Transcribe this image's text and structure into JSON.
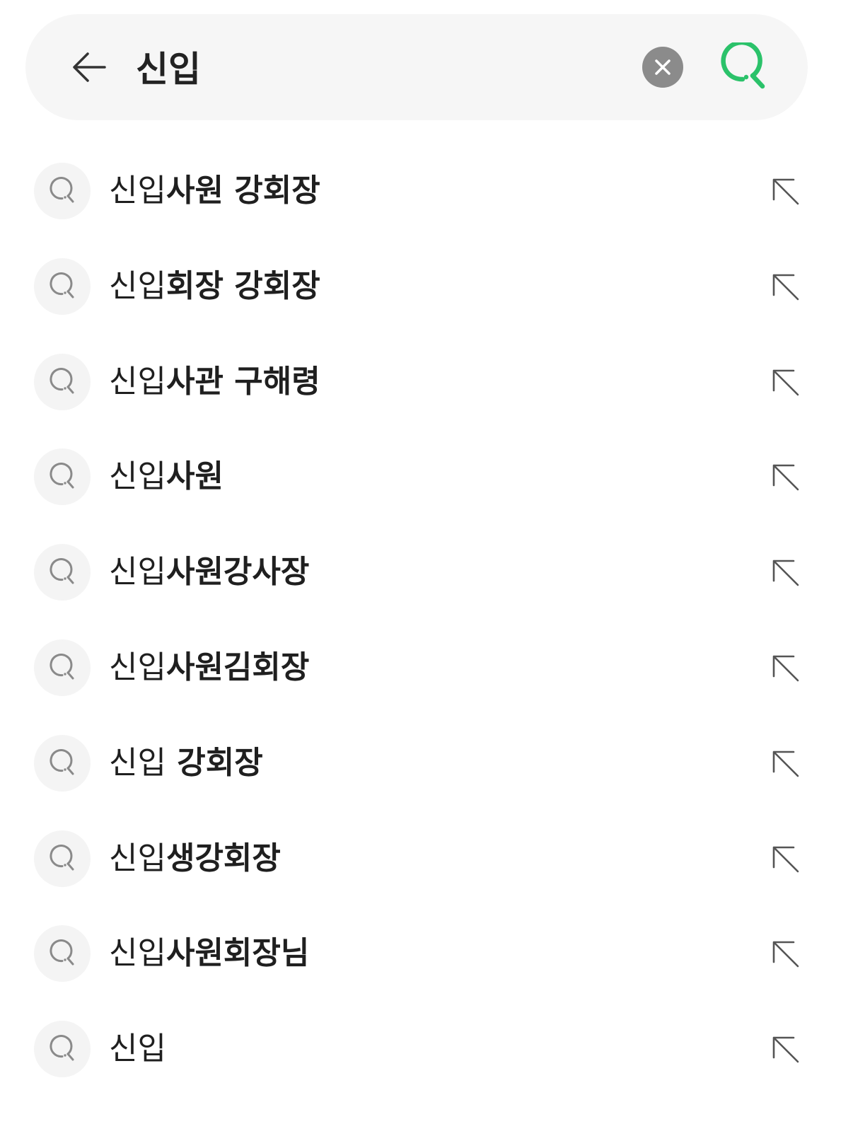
{
  "search": {
    "query": "신입",
    "accent_color": "#2bc26a",
    "clear_color": "#8b8b8b",
    "back_icon": "arrow-left-icon",
    "clear_icon": "close-circle-icon",
    "search_icon": "search-icon"
  },
  "suggestions": [
    {
      "match": "신입",
      "rest": "사원 강회장"
    },
    {
      "match": "신입",
      "rest": "회장 강회장"
    },
    {
      "match": "신입",
      "rest": "사관 구해령"
    },
    {
      "match": "신입",
      "rest": "사원"
    },
    {
      "match": "신입",
      "rest": "사원강사장"
    },
    {
      "match": "신입",
      "rest": "사원김회장"
    },
    {
      "match": "신입",
      "rest": " 강회장"
    },
    {
      "match": "신입",
      "rest": "생강회장"
    },
    {
      "match": "신입",
      "rest": "사원회장님"
    },
    {
      "match": "신입",
      "rest": ""
    }
  ],
  "suggestion_icons": {
    "leading": "search-icon",
    "trailing": "arrow-up-left-icon"
  }
}
